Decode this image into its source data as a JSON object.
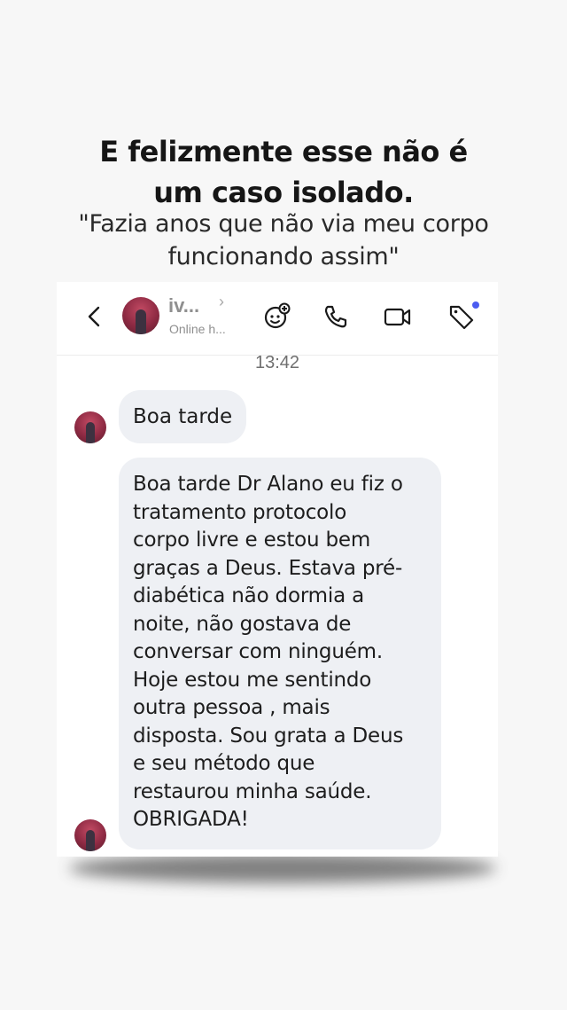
{
  "headline": {
    "line1": "E felizmente esse não é",
    "line2": "um caso isolado."
  },
  "quote": {
    "line1": "\"Fazia anos que não via meu corpo",
    "line2": "funcionando assim\""
  },
  "chat": {
    "header": {
      "contact_name": "iv...",
      "name_chevron": "›",
      "status": "Online h...",
      "icons": [
        "back-icon",
        "sticker-icon",
        "phone-icon",
        "video-icon",
        "tag-icon"
      ]
    },
    "timestamp": "13:42",
    "messages": [
      {
        "lines": [
          "Boa tarde"
        ]
      },
      {
        "lines": [
          "Boa tarde Dr Alano eu fiz o",
          "tratamento protocolo",
          "corpo livre e estou bem",
          "graças a Deus. Estava pré-",
          "diabética não dormia a",
          "noite, não gostava de",
          "conversar com ninguém.",
          "Hoje estou me sentindo",
          "outra pessoa , mais",
          "disposta. Sou grata a Deus",
          "e seu método que",
          "restaurou minha saúde.",
          "OBRIGADA!"
        ]
      }
    ]
  },
  "colors": {
    "background": "#f7f7f7",
    "bubble": "#eef0f4",
    "accent_dot": "#4b5cf0",
    "avatar": "#8e2a43"
  }
}
